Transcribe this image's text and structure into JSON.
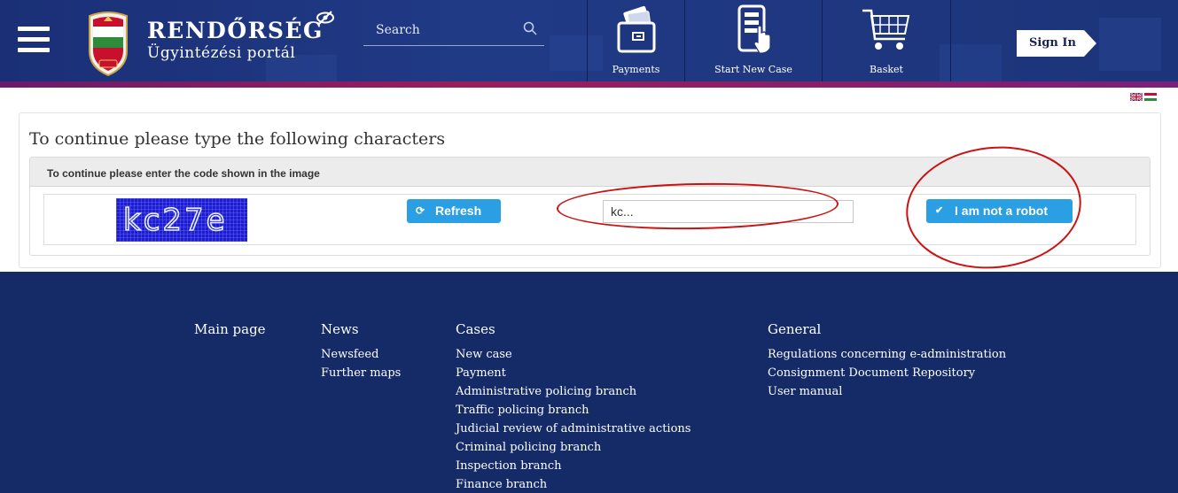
{
  "header": {
    "brand_title": "RENDŐRSÉG",
    "brand_subtitle": "Ügyintézési portál",
    "search_placeholder": "Search",
    "nav": [
      {
        "label": "Payments",
        "icon": "wallet-icon"
      },
      {
        "label": "Start New Case",
        "icon": "form-hand-icon"
      },
      {
        "label": "Basket",
        "icon": "shopping-cart-icon"
      }
    ],
    "signin_label": "Sign In",
    "colors": {
      "header_bg": "#1a2f76",
      "stripe": "#9a1d5a"
    }
  },
  "main": {
    "heading": "To continue please type the following characters",
    "instruction": "To continue please enter the code shown in the image",
    "captcha_text": "kc27e",
    "refresh_label": "Refresh",
    "code_value": "kc...",
    "robot_label": "I am not a robot",
    "accent": "#2a9fe3"
  },
  "footer": {
    "columns": [
      {
        "heading": "Main page",
        "links": []
      },
      {
        "heading": "News",
        "links": [
          "Newsfeed",
          "Further maps"
        ]
      },
      {
        "heading": "Cases",
        "links": [
          "New case",
          "Payment",
          "Administrative policing branch",
          "Traffic policing branch",
          "Judicial review of administrative actions",
          "Criminal policing branch",
          "Inspection branch",
          "Finance branch"
        ]
      },
      {
        "heading": "General",
        "links": [
          "Regulations concerning e-administration",
          "Consignment Document Repository",
          "User manual"
        ]
      }
    ]
  }
}
